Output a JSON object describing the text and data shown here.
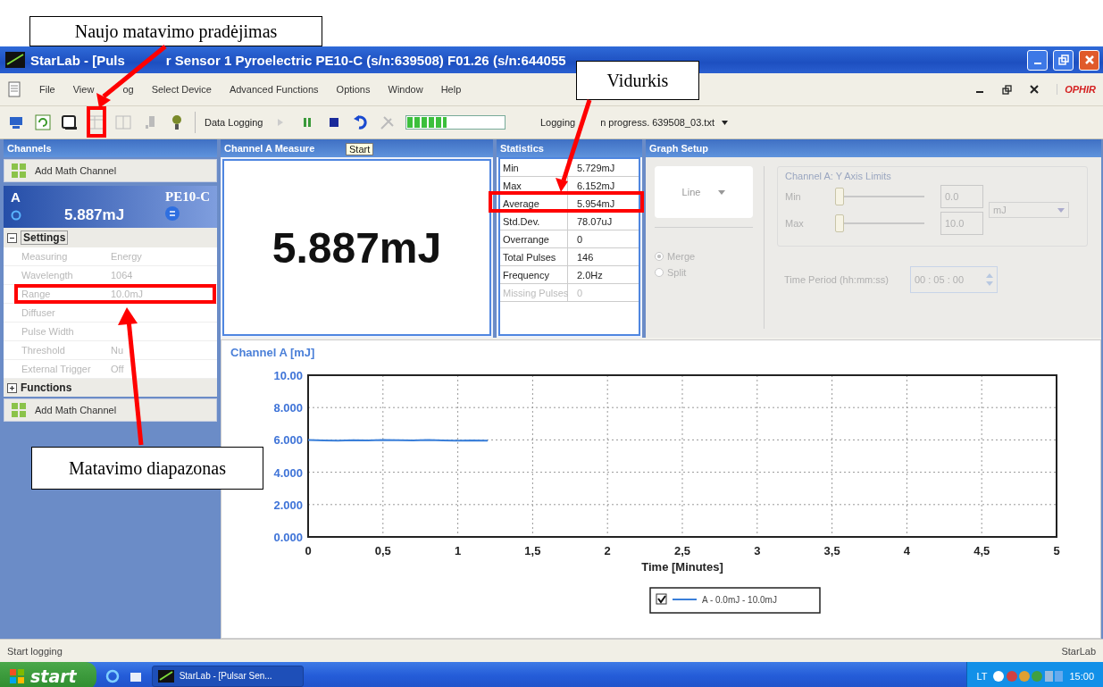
{
  "window": {
    "title_parts": [
      "StarLab - [Puls",
      "r Sensor 1 Pyroelectric PE10-C (s/n:639508)  F01.26 (s/n:644055"
    ]
  },
  "menu": [
    "File",
    "View",
    "og",
    "Select Device",
    "Advanced Functions",
    "Options",
    "Window",
    "Help"
  ],
  "logo": "OPHIR",
  "toolbar": {
    "label": "Data Logging",
    "progress": {
      "level": 0.4
    },
    "status_parts": [
      "Logging",
      "n progress. 639508_03.txt"
    ]
  },
  "tooltip": "Start",
  "sidebar": {
    "title": "Channels",
    "add_button": "Add Math Channel",
    "channel": {
      "name": "A",
      "sensor": "PE10-C",
      "reading": "5.887mJ"
    },
    "sections": [
      {
        "title": "Settings",
        "expanded": true,
        "rows": [
          {
            "label": "Measuring",
            "value": "Energy"
          },
          {
            "label": "Wavelength",
            "value": "1064"
          },
          {
            "label": "Range",
            "value": "10.0mJ"
          },
          {
            "label": "Diffuser"
          },
          {
            "label": "Pulse Width"
          },
          {
            "label": "Threshold",
            "value": "Nu"
          },
          {
            "label": "External Trigger",
            "value": "Off"
          }
        ]
      },
      {
        "title": "Functions",
        "expanded": false
      }
    ],
    "add_button_2": "Add Math Channel"
  },
  "measurement": {
    "title": "Channel A Measure",
    "value": "5.887mJ"
  },
  "statistics": {
    "title": "Statistics",
    "rows": [
      {
        "label": "Min",
        "value": "5.729mJ",
        "disabled": false
      },
      {
        "label": "Max",
        "value": "6.152mJ",
        "disabled": false
      },
      {
        "label": "Average",
        "value": "5.954mJ",
        "disabled": false
      },
      {
        "label": "Std.Dev.",
        "value": "78.07uJ",
        "disabled": false
      },
      {
        "label": "Overrange",
        "value": "0",
        "disabled": false
      },
      {
        "label": "Total Pulses",
        "value": "146",
        "disabled": false
      },
      {
        "label": "Frequency",
        "value": "2.0Hz",
        "disabled": false
      },
      {
        "label": "Missing Pulses",
        "value": "0",
        "disabled": true
      }
    ]
  },
  "graph_setup": {
    "title": "Graph Setup",
    "disabled": true,
    "type": "Line",
    "modes": [
      {
        "label": "Merge",
        "selected": true
      },
      {
        "label": "Split",
        "selected": false
      }
    ],
    "axis_group": "Channel A: Y Axis Limits",
    "limits": [
      {
        "label": "Min",
        "value": "0.0",
        "level": 0
      },
      {
        "label": "Max",
        "value": "10.0",
        "level": 0
      }
    ],
    "unit": "mJ",
    "time_label": "Time Period (hh:mm:ss)",
    "time_value": "00 : 05 : 00"
  },
  "graph": {
    "legend_checked": true,
    "chart_data": {
      "type": "line",
      "title": "Channel A [mJ]",
      "xlabel": "Time [Minutes]",
      "x": [
        0,
        0.1,
        0.2,
        0.3,
        0.4,
        0.5,
        0.6,
        0.7,
        0.8,
        0.9,
        1.0,
        1.1,
        1.2
      ],
      "series": [
        {
          "name": "A - 0.0mJ - 10.0mJ",
          "color": "#3a7fd9",
          "values": [
            6.0,
            5.97,
            5.95,
            5.98,
            5.96,
            6.0,
            5.98,
            5.97,
            5.99,
            5.96,
            5.95,
            5.97,
            5.95
          ]
        }
      ],
      "xlim": [
        0,
        5
      ],
      "ylim": [
        0,
        10
      ],
      "grid": true,
      "xticks": [
        0,
        {
          "value": 0.5,
          "label": "0,5"
        },
        1,
        {
          "value": 1.5,
          "label": "1,5"
        },
        2,
        {
          "value": 2.5,
          "label": "2,5"
        },
        3,
        {
          "value": 3.5,
          "label": "3,5"
        },
        4,
        {
          "value": 4.5,
          "label": "4,5"
        },
        5
      ],
      "yticks": [
        {
          "value": 0,
          "label": "0.000"
        },
        {
          "value": 2,
          "label": "2.000"
        },
        {
          "value": 4,
          "label": "4.000"
        },
        {
          "value": 6,
          "label": "6.000"
        },
        {
          "value": 8,
          "label": "8.000"
        },
        {
          "value": 10,
          "label": "10.00"
        }
      ]
    }
  },
  "status_bar": {
    "left": "Start logging",
    "right": "StarLab"
  },
  "taskbar": {
    "start": "start",
    "tasks": [
      {
        "label": "StarLab - [Pulsar Sen...",
        "selected": false
      }
    ],
    "language": "LT",
    "clock": "15:00"
  },
  "annotations": [
    {
      "text": "Naujo matavimo pradėjimas"
    },
    {
      "text": "Vidurkis"
    },
    {
      "text": "Matavimo diapazonas"
    }
  ]
}
